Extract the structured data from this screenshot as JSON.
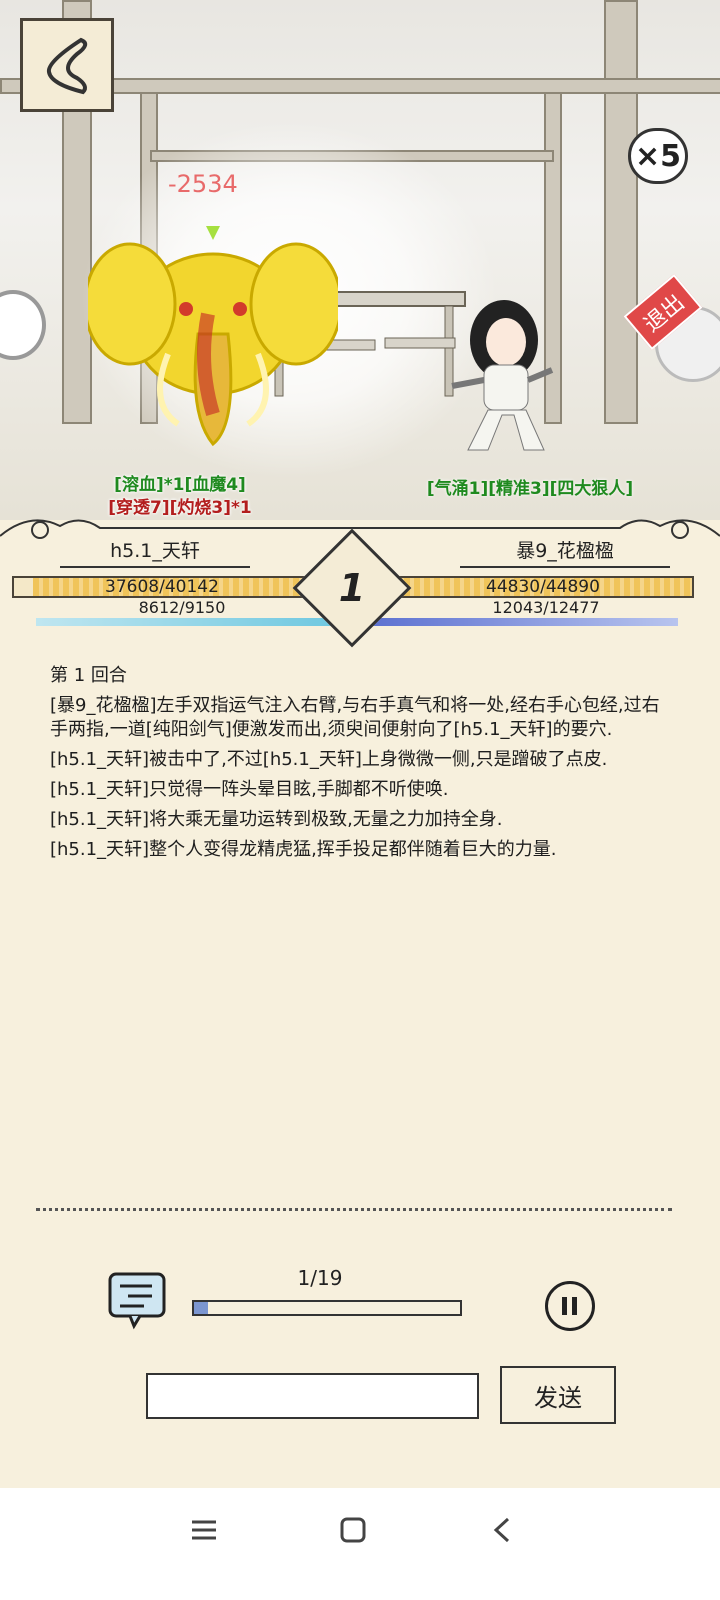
{
  "battle": {
    "damage_popup": "-2534",
    "speed_label": "×5",
    "exit_label": "退出",
    "left": {
      "name": "h5.1_天轩",
      "status_line1": [
        "[溶血]*1",
        "[血魔4]"
      ],
      "status_line2": [
        "[穿透7]",
        "[灼烧3]*1"
      ],
      "hp_text": "37608/40142",
      "hp_fraction": 0.937,
      "mp_text": "8612/9150",
      "mp_fraction": 0.941
    },
    "right": {
      "name": "暴9_花楹楹",
      "status_line": [
        "[气涌1]",
        "[精准3]",
        "[四大狠人]"
      ],
      "hp_text": "44830/44890",
      "hp_fraction": 0.999,
      "mp_text": "12043/12477",
      "mp_fraction": 0.965
    },
    "round_number": "1"
  },
  "log": {
    "round_title": "第 1 回合",
    "entries": [
      "[暴9_花楹楹]左手双指运气注入右臂,与右手真气和将一处,经右手心包经,过右手两指,一道[纯阳剑气]便激发而出,须臾间便射向了[h5.1_天轩]的要穴.",
      "[h5.1_天轩]被击中了,不过[h5.1_天轩]上身微微一侧,只是蹭破了点皮.",
      "[h5.1_天轩]只觉得一阵头晕目眩,手脚都不听使唤.",
      "[h5.1_天轩]将大乘无量功运转到极致,无量之力加持全身.",
      "[h5.1_天轩]整个人变得龙精虎猛,挥手投足都伴随着巨大的力量."
    ]
  },
  "playback": {
    "progress_label": "1/19",
    "progress_fraction": 0.053
  },
  "chat": {
    "input_value": "",
    "send_label": "发送"
  },
  "colors": {
    "background": "#f7f0dd",
    "hp_bar": "#f0c45a",
    "mp_left": "#6fc8e0",
    "mp_right": "#5a6fd0",
    "status_green": "#1f8a1f",
    "status_red": "#b31e1e"
  },
  "icons": [
    "back-arrow-icon",
    "chat-log-icon",
    "pause-icon",
    "menu-icon",
    "home-icon",
    "back-icon"
  ]
}
